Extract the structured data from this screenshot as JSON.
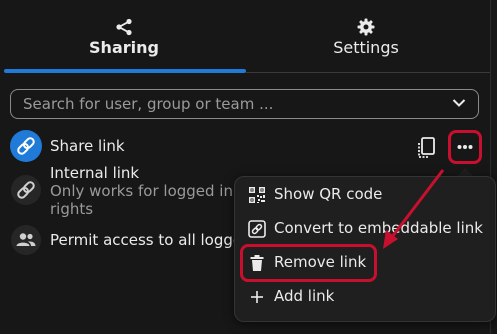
{
  "tabs": [
    {
      "label": "Sharing",
      "icon": "share-icon",
      "active": true
    },
    {
      "label": "Settings",
      "icon": "gear-icon",
      "active": false
    }
  ],
  "search": {
    "placeholder": "Search for user, group or team ..."
  },
  "links": {
    "share_link": {
      "label": "Share link",
      "icon": "link-icon"
    },
    "internal_link": {
      "title": "Internal link",
      "subtitle_line1": "Only works for logged in",
      "subtitle_line2": "rights",
      "icon": "link-icon"
    },
    "permit_access": {
      "label": "Permit access to all logge",
      "icon": "group-icon"
    }
  },
  "context_menu": {
    "items": [
      {
        "label": "Show QR code",
        "icon": "qr-code-icon"
      },
      {
        "label": "Convert to embeddable link",
        "icon": "embed-link-icon"
      },
      {
        "label": "Remove link",
        "icon": "trash-icon"
      },
      {
        "label": "Add link",
        "icon": "plus-icon"
      }
    ]
  },
  "colors": {
    "accent": "#1f7ad8",
    "highlight": "#c8102e",
    "background": "#171717"
  }
}
